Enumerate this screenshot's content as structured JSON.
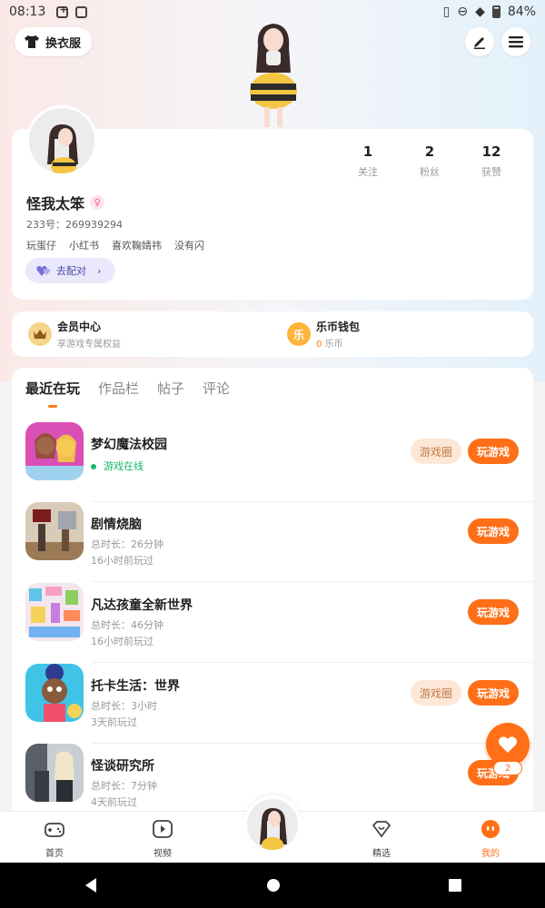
{
  "status_bar": {
    "time": "08:13",
    "battery": "84%"
  },
  "header": {
    "outfit_label": "换衣服"
  },
  "profile": {
    "stats": [
      {
        "value": "1",
        "label": "关注"
      },
      {
        "value": "2",
        "label": "粉丝"
      },
      {
        "value": "12",
        "label": "获赞"
      }
    ],
    "username": "怪我太笨",
    "uid": "233号：269939294",
    "tags": [
      "玩蛋仔",
      "小红书",
      "喜欢鞠婧祎",
      "没有闪"
    ],
    "pair_label": "去配对"
  },
  "wallet": {
    "vip": {
      "title": "会员中心",
      "subtitle": "享游戏专属权益"
    },
    "coins": {
      "title": "乐币钱包",
      "amount": "0",
      "unit": "乐币"
    }
  },
  "tabs": [
    "最近在玩",
    "作品栏",
    "帖子",
    "评论"
  ],
  "games": [
    {
      "name": "梦幻魔法校园",
      "status": "游戏在线",
      "circle": "游戏圈",
      "play": "玩游戏"
    },
    {
      "name": "剧情烧脑",
      "duration": "总时长：26分钟",
      "last": "16小时前玩过",
      "play": "玩游戏"
    },
    {
      "name": "凡达孩童全新世界",
      "duration": "总时长：46分钟",
      "last": "16小时前玩过",
      "play": "玩游戏"
    },
    {
      "name": "托卡生活：世界",
      "duration": "总时长：3小时",
      "last": "3天前玩过",
      "circle": "游戏圈",
      "play": "玩游戏"
    },
    {
      "name": "怪谈研究所",
      "duration": "总时长：7分钟",
      "last": "4天前玩过",
      "play": "玩游戏"
    }
  ],
  "float": {
    "badge": "2"
  },
  "nav": [
    {
      "label": "首页"
    },
    {
      "label": "视频"
    },
    {
      "label": "精选"
    },
    {
      "label": "我的"
    }
  ],
  "colors": {
    "accent": "#ff6f17",
    "online": "#18b86a",
    "pair": "#4d46a6"
  }
}
